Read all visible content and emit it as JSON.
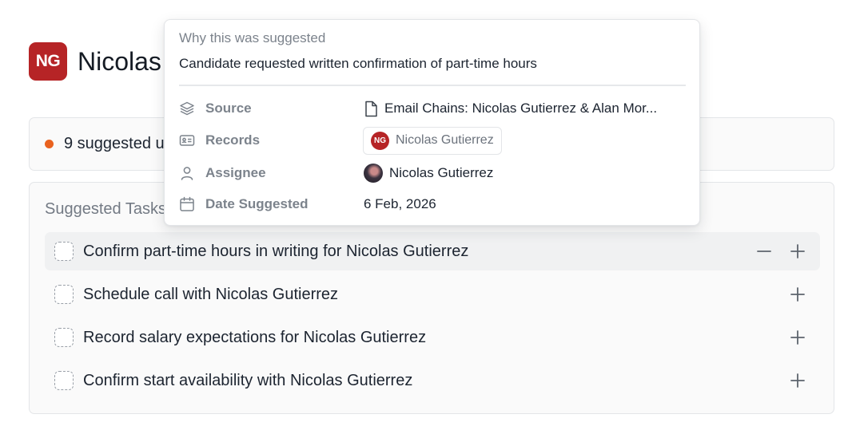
{
  "header": {
    "avatar_initials": "NG",
    "title": "Nicolas",
    "avatar_color": "#b62426"
  },
  "banner": {
    "text": "9 suggested u",
    "dot_color": "#e9621f"
  },
  "tasks": {
    "title": "Suggested Tasks",
    "items": [
      {
        "label": "Confirm part-time hours in writing for Nicolas Gutierrez",
        "hovered": true,
        "actions": [
          "dismiss",
          "add"
        ]
      },
      {
        "label": "Schedule call with Nicolas Gutierrez",
        "hovered": false,
        "actions": [
          "add"
        ]
      },
      {
        "label": "Record salary expectations for Nicolas Gutierrez",
        "hovered": false,
        "actions": [
          "add"
        ]
      },
      {
        "label": "Confirm start availability with Nicolas Gutierrez",
        "hovered": false,
        "actions": [
          "add"
        ]
      }
    ]
  },
  "popover": {
    "heading": "Why this was suggested",
    "reason": "Candidate requested written confirmation of part-time hours",
    "rows": {
      "source": {
        "label": "Source",
        "icon": "layers-icon",
        "value": "Email Chains: Nicolas Gutierrez & Alan Mor...",
        "value_icon": "document-icon"
      },
      "records": {
        "label": "Records",
        "icon": "id-card-icon",
        "value": "Nicolas Gutierrez",
        "value_initials": "NG"
      },
      "assignee": {
        "label": "Assignee",
        "icon": "user-icon",
        "value": "Nicolas Gutierrez",
        "value_icon": "avatar-photo"
      },
      "date": {
        "label": "Date Suggested",
        "icon": "calendar-icon",
        "value": "6 Feb, 2026"
      }
    }
  }
}
